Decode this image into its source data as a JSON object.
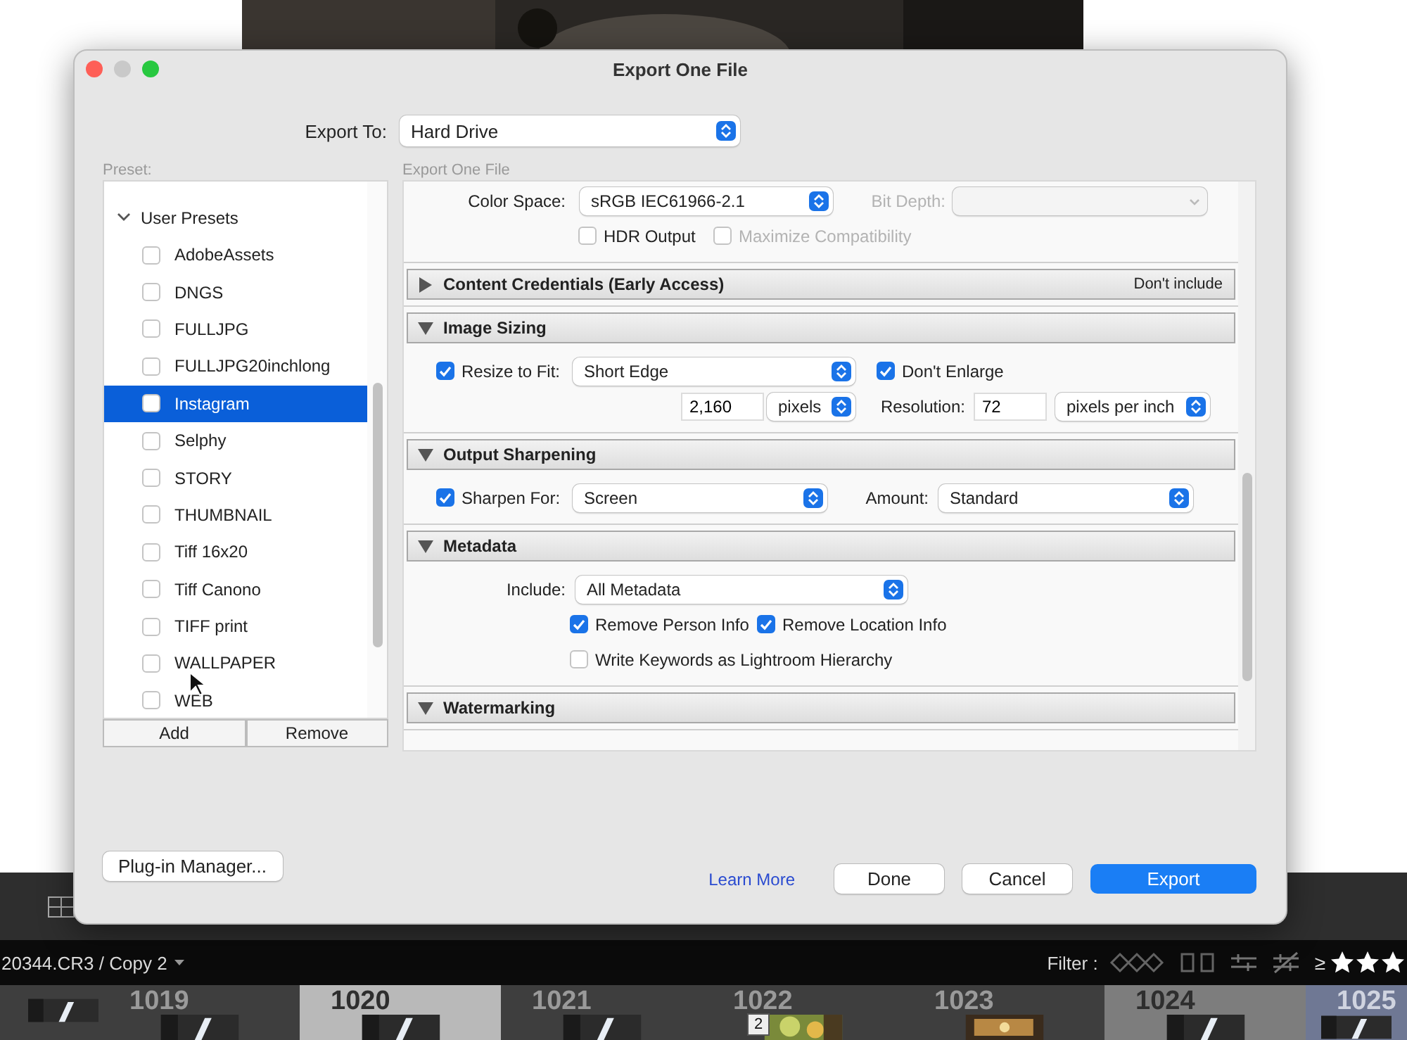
{
  "window": {
    "title": "Export One File"
  },
  "export_to": {
    "label": "Export To:",
    "value": "Hard Drive"
  },
  "presets": {
    "label": "Preset:",
    "groups": [
      {
        "label": "User Presets",
        "expanded": true,
        "children": [
          {
            "label": "AdobeAssets",
            "checked": false,
            "selected": false
          },
          {
            "label": "DNGS",
            "checked": false,
            "selected": false
          },
          {
            "label": "FULLJPG",
            "checked": false,
            "selected": false
          },
          {
            "label": "FULLJPG20inchlong",
            "checked": false,
            "selected": false
          },
          {
            "label": "Instagram",
            "checked": false,
            "selected": true
          },
          {
            "label": "Selphy",
            "checked": false,
            "selected": false
          },
          {
            "label": "STORY",
            "checked": false,
            "selected": false
          },
          {
            "label": "THUMBNAIL",
            "checked": false,
            "selected": false
          },
          {
            "label": "Tiff 16x20",
            "checked": false,
            "selected": false
          },
          {
            "label": "Tiff Canono",
            "checked": false,
            "selected": false
          },
          {
            "label": "TIFF print",
            "checked": false,
            "selected": false
          },
          {
            "label": "WALLPAPER",
            "checked": false,
            "selected": false
          },
          {
            "label": "WEB",
            "checked": false,
            "selected": false
          }
        ]
      }
    ],
    "buttons": [
      "Add",
      "Remove"
    ]
  },
  "settings": {
    "label": "Export One File",
    "sections": [
      {
        "lines": [
          {
            "items": [
              {
                "kind": "label",
                "text": "Color Space:"
              },
              {
                "kind": "select",
                "value": "sRGB IEC61966-2.1"
              },
              {
                "kind": "label",
                "text": "Bit Depth:",
                "disabled": true
              },
              {
                "kind": "select",
                "disabled": true
              }
            ]
          },
          {
            "items": [
              {
                "kind": "checkbox",
                "label": "HDR Output",
                "checked": false
              },
              {
                "kind": "checkbox",
                "label": "Maximize Compatibility",
                "checked": false,
                "disabled": true
              }
            ]
          }
        ]
      },
      {
        "title": "Content Credentials (Early Access)",
        "expanded": false,
        "summary": "Don't include"
      },
      {
        "title": "Image Sizing",
        "expanded": true,
        "lines": [
          {
            "items": [
              {
                "kind": "checkbox",
                "label": "Resize to Fit:",
                "checked": true
              },
              {
                "kind": "select",
                "value": "Short Edge"
              },
              {
                "kind": "checkbox",
                "label": "Don't Enlarge",
                "checked": true
              }
            ]
          },
          {
            "items": [
              {
                "kind": "input",
                "value": "2,160"
              },
              {
                "kind": "select",
                "value": "pixels"
              },
              {
                "kind": "label",
                "text": "Resolution:"
              },
              {
                "kind": "input",
                "value": "72"
              },
              {
                "kind": "select",
                "value": "pixels per inch"
              }
            ]
          }
        ]
      },
      {
        "title": "Output Sharpening",
        "expanded": true,
        "lines": [
          {
            "items": [
              {
                "kind": "checkbox",
                "label": "Sharpen For:",
                "checked": true
              },
              {
                "kind": "select",
                "value": "Screen"
              },
              {
                "kind": "label",
                "text": "Amount:"
              },
              {
                "kind": "select",
                "value": "Standard"
              }
            ]
          }
        ]
      },
      {
        "title": "Metadata",
        "expanded": true,
        "lines": [
          {
            "items": [
              {
                "kind": "label",
                "text": "Include:"
              },
              {
                "kind": "select",
                "value": "All Metadata"
              }
            ]
          },
          {
            "items": [
              {
                "kind": "checkbox",
                "label": "Remove Person Info",
                "checked": true
              },
              {
                "kind": "checkbox",
                "label": "Remove Location Info",
                "checked": true
              }
            ]
          },
          {
            "items": [
              {
                "kind": "checkbox",
                "label": "Write Keywords as Lightroom Hierarchy",
                "checked": false
              }
            ]
          }
        ]
      },
      {
        "title": "Watermarking",
        "expanded": true
      }
    ]
  },
  "plugin_manager": "Plug-in Manager...",
  "learn_more": "Learn More",
  "dialog_buttons": [
    {
      "label": "Done",
      "kind": "secondary"
    },
    {
      "label": "Cancel",
      "kind": "secondary"
    },
    {
      "label": "Export",
      "kind": "primary"
    }
  ],
  "library": {
    "photo_name": "20344.CR3 / Copy 2",
    "filter_label": "Filter :",
    "rating_symbol": "≥",
    "stars": 3,
    "filmstrip": [
      {
        "selected": false,
        "active": false,
        "marked": false
      },
      {
        "number": "1019",
        "selected": false,
        "active": false,
        "marked": false
      },
      {
        "number": "1020",
        "selected": true,
        "active": true,
        "marked": false
      },
      {
        "number": "1021",
        "selected": false,
        "active": false,
        "marked": false
      },
      {
        "number": "1022",
        "selected": false,
        "active": false,
        "marked": false,
        "badge": "2"
      },
      {
        "number": "1023",
        "selected": false,
        "active": false,
        "marked": false
      },
      {
        "number": "1024",
        "selected": true,
        "active": false,
        "marked": false
      },
      {
        "number": "1025",
        "selected": false,
        "active": false,
        "marked": true
      }
    ]
  }
}
